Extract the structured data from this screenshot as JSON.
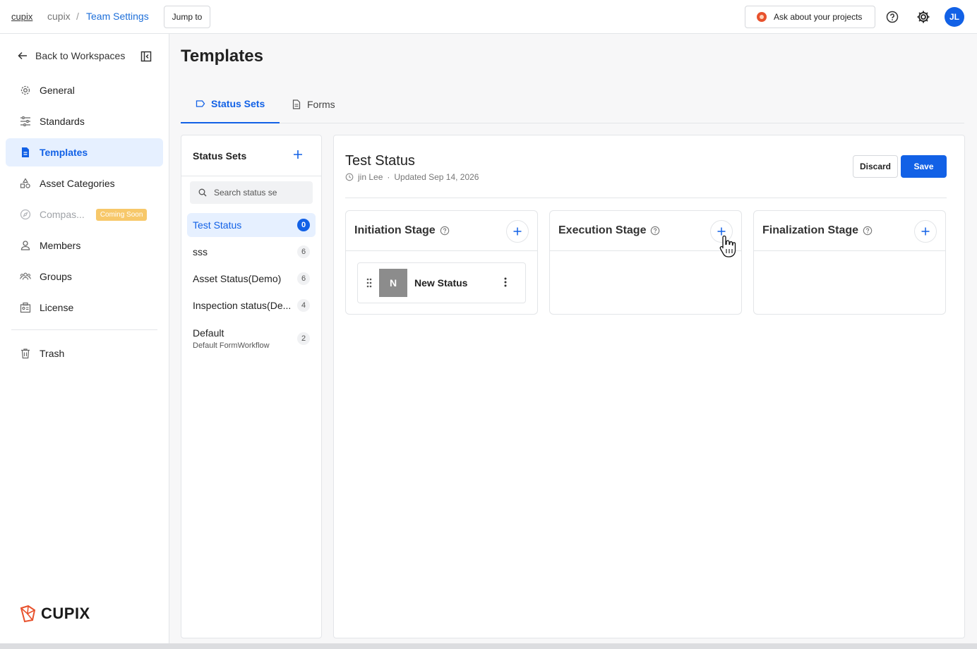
{
  "topbar": {
    "logo_text": "cupix",
    "breadcrumb_1": "cupix",
    "breadcrumb_sep": "/",
    "breadcrumb_2": "Team Settings",
    "jump_label": "Jump to",
    "ask_label": "Ask about your projects",
    "avatar_initials": "JL"
  },
  "sidebar": {
    "back_label": "Back to Workspaces",
    "items": [
      {
        "label": "General",
        "icon": "gear-icon"
      },
      {
        "label": "Standards",
        "icon": "sliders-icon"
      },
      {
        "label": "Templates",
        "icon": "document-icon"
      },
      {
        "label": "Asset Categories",
        "icon": "shapes-icon"
      },
      {
        "label": "Compas...",
        "icon": "compass-icon",
        "badge": "Coming Soon"
      },
      {
        "label": "Members",
        "icon": "person-icon"
      },
      {
        "label": "Groups",
        "icon": "group-icon"
      },
      {
        "label": "License",
        "icon": "license-icon"
      },
      {
        "label": "Trash",
        "icon": "trash-icon"
      }
    ],
    "brand": "CUPIX"
  },
  "main": {
    "title": "Templates",
    "tabs": [
      {
        "label": "Status Sets",
        "active": true
      },
      {
        "label": "Forms",
        "active": false
      }
    ]
  },
  "status_sets": {
    "heading": "Status Sets",
    "search_placeholder": "Search status se",
    "items": [
      {
        "name": "Test Status",
        "count": "0"
      },
      {
        "name": "sss",
        "count": "6"
      },
      {
        "name": "Asset Status(Demo)",
        "count": "6"
      },
      {
        "name": "Inspection status(De...",
        "count": "4"
      },
      {
        "name": "Default",
        "count": "2",
        "subtitle": "Default FormWorkflow"
      }
    ]
  },
  "editor": {
    "title": "Test Status",
    "author": "jin Lee",
    "dot": "·",
    "updated": "Updated Sep 14, 2026",
    "discard_label": "Discard",
    "save_label": "Save",
    "stages": [
      {
        "title": "Initiation Stage",
        "statuses": [
          {
            "initial": "N",
            "name": "New Status"
          }
        ]
      },
      {
        "title": "Execution Stage",
        "statuses": []
      },
      {
        "title": "Finalization Stage",
        "statuses": []
      }
    ]
  },
  "colors": {
    "accent": "#1261e6",
    "active_bg": "#e6f0ff",
    "badge": "#f7c86a"
  }
}
